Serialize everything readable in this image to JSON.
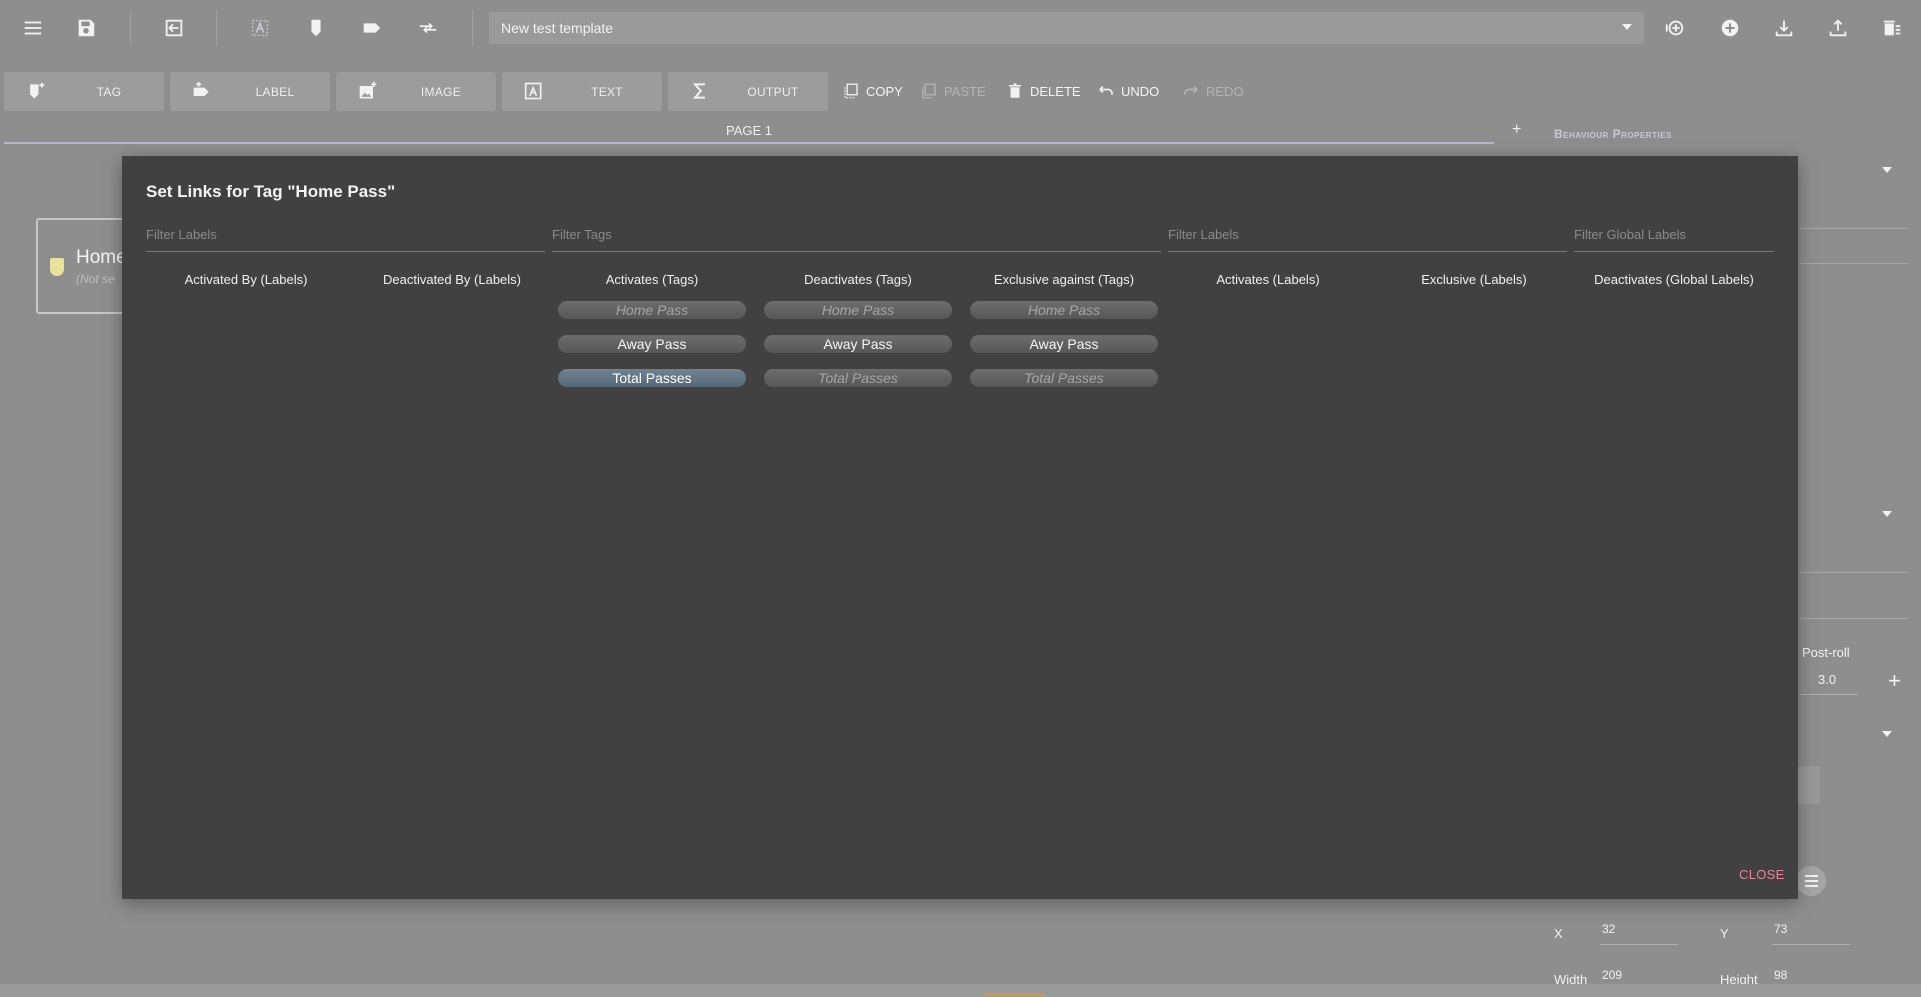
{
  "toolbar": {
    "template_name": "New test template"
  },
  "elements": {
    "tag": "TAG",
    "label": "LABEL",
    "image": "IMAGE",
    "text": "TEXT",
    "output": "OUTPUT"
  },
  "actions": {
    "copy": "COPY",
    "paste": "PASTE",
    "delete": "DELETE",
    "undo": "UNDO",
    "redo": "REDO"
  },
  "page_tab": "PAGE 1",
  "add_page": "+",
  "canvas_tag": {
    "name": "Home",
    "sub": "(Not se"
  },
  "properties": {
    "title": "Behaviour Properties",
    "postroll_label": "Post-roll",
    "postroll_value": "3.0",
    "x_label": "X",
    "x_value": "32",
    "y_label": "Y",
    "y_value": "73",
    "width_label": "Width",
    "width_value": "209",
    "height_label": "Height",
    "height_value": "98"
  },
  "modal": {
    "title": "Set Links for Tag \"Home Pass\"",
    "filters": {
      "labels_left": "Filter Labels",
      "tags": "Filter Tags",
      "labels_right": "Filter Labels",
      "global_labels": "Filter Global Labels"
    },
    "columns": {
      "activated_by": "Activated By (Labels)",
      "deactivated_by": "Deactivated By (Labels)",
      "activates_tags": "Activates (Tags)",
      "deactivates_tags": "Deactivates (Tags)",
      "exclusive_tags": "Exclusive against (Tags)",
      "activates_labels": "Activates (Labels)",
      "exclusive_labels": "Exclusive (Labels)",
      "deactivates_global": "Deactivates (Global Labels)"
    },
    "tag_items": [
      "Home Pass",
      "Away Pass",
      "Total Passes"
    ],
    "close": "CLOSE"
  }
}
